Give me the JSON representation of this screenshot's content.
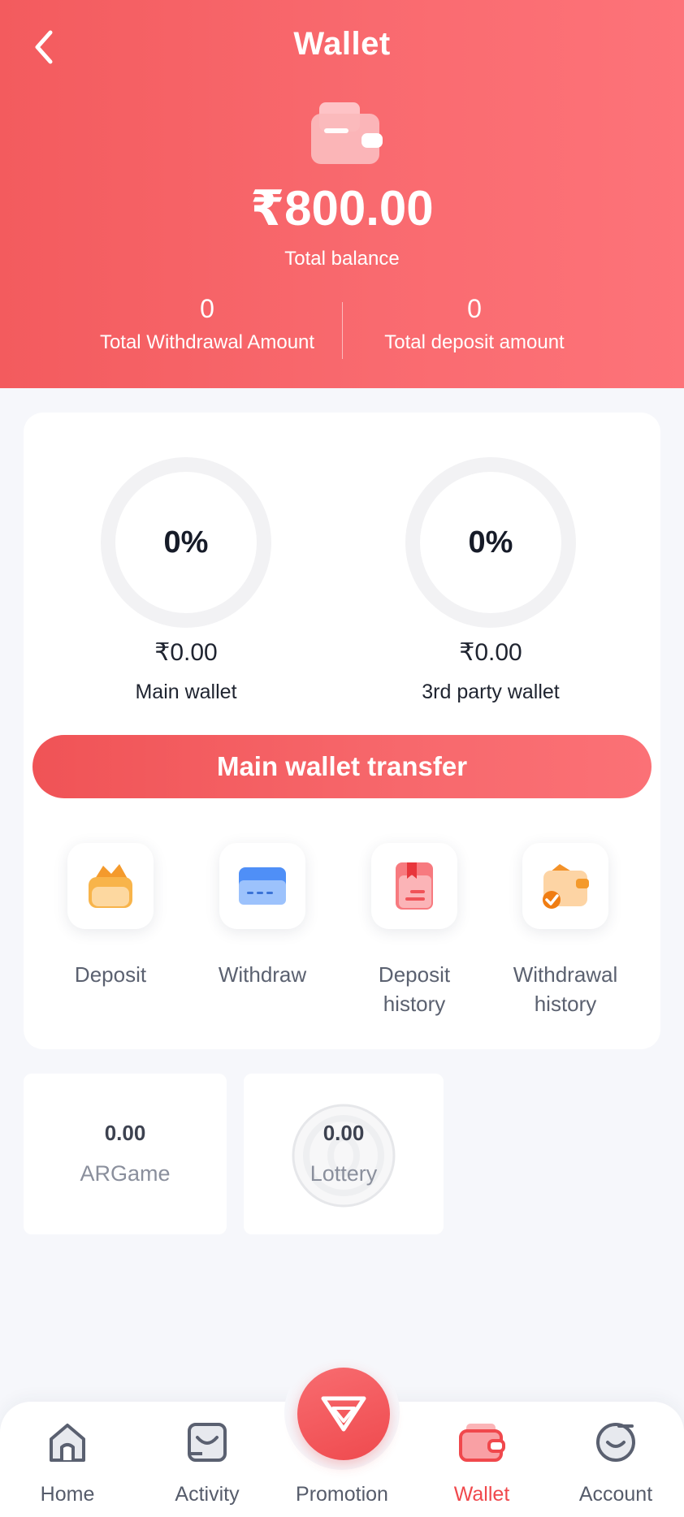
{
  "header": {
    "title": "Wallet",
    "back_icon": "chevron-left-icon",
    "hero_icon": "wallet-icon",
    "total_balance": "₹800.00",
    "total_balance_label": "Total balance",
    "total_withdrawal_value": "0",
    "total_withdrawal_label": "Total Withdrawal Amount",
    "total_deposit_value": "0",
    "total_deposit_label": "Total deposit amount",
    "accent_color": "#f35b5e"
  },
  "wallets": {
    "main": {
      "percent": "0%",
      "percent_value": 0,
      "amount": "₹0.00",
      "label": "Main wallet"
    },
    "third_party": {
      "percent": "0%",
      "percent_value": 0,
      "amount": "₹0.00",
      "label": "3rd party wallet"
    }
  },
  "transfer_button": {
    "label": "Main wallet transfer"
  },
  "actions": [
    {
      "label": "Deposit",
      "icon": "deposit-icon"
    },
    {
      "label": "Withdraw",
      "icon": "withdraw-card-icon"
    },
    {
      "label": "Deposit history",
      "icon": "deposit-history-icon"
    },
    {
      "label": "Withdrawal history",
      "icon": "withdrawal-history-icon"
    }
  ],
  "games": [
    {
      "amount": "0.00",
      "name": "ARGame"
    },
    {
      "amount": "0.00",
      "name": "Lottery"
    }
  ],
  "bottom_nav": {
    "items": [
      {
        "label": "Home",
        "icon": "home-icon",
        "active": false
      },
      {
        "label": "Activity",
        "icon": "activity-icon",
        "active": false
      },
      {
        "label": "Promotion",
        "icon": "diamond-icon",
        "active": false
      },
      {
        "label": "Wallet",
        "icon": "wallet-icon",
        "active": true
      },
      {
        "label": "Account",
        "icon": "account-icon",
        "active": false
      }
    ],
    "active_color": "#f0484c"
  }
}
